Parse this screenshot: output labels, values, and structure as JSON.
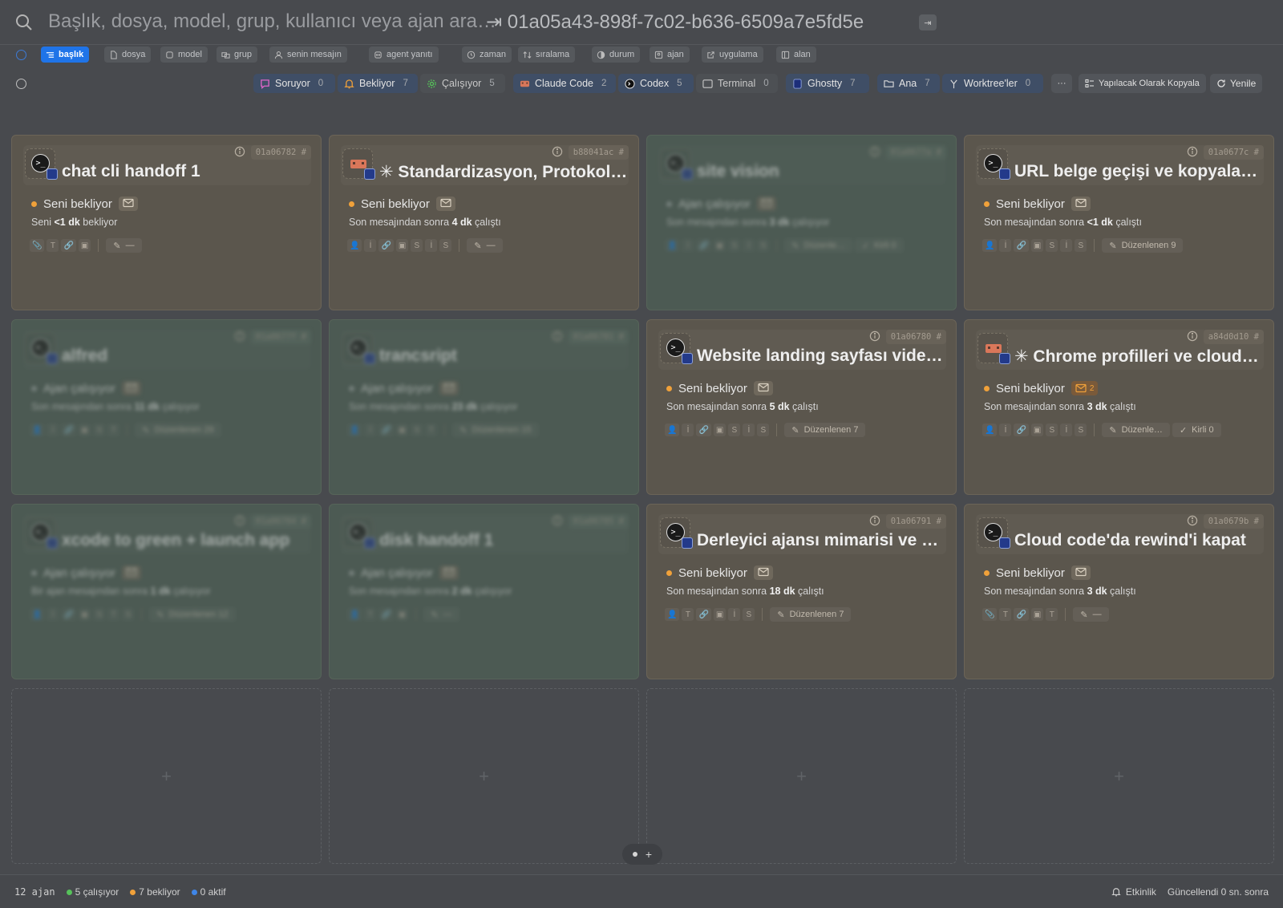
{
  "search": {
    "placeholder": "Başlık, dosya, model, grup, kullanıcı veya ajan ara…",
    "current_id": "01a05a43-898f-7c02-b636-6509a7e5fd5e",
    "arrow": "⇥",
    "tab_key": "⇥"
  },
  "filters": [
    {
      "label": "başlık",
      "icon": "list-icon",
      "active": true
    },
    {
      "label": "dosya",
      "icon": "file-icon"
    },
    {
      "label": "model",
      "icon": "cube-icon"
    },
    {
      "label": "grup",
      "icon": "group-icon"
    },
    {
      "label": "senin mesajın",
      "icon": "user-icon"
    },
    {
      "label": "agent yanıtı",
      "icon": "bot-icon"
    },
    {
      "label": "zaman",
      "icon": "clock-icon"
    },
    {
      "label": "sıralama",
      "icon": "sort-icon"
    },
    {
      "label": "durum",
      "icon": "half-circle-icon"
    },
    {
      "label": "ajan",
      "icon": "agent-icon"
    },
    {
      "label": "uygulama",
      "icon": "external-icon"
    },
    {
      "label": "alan",
      "icon": "panel-icon"
    }
  ],
  "status_bar": {
    "soruyor": {
      "label": "Soruyor",
      "count": "0"
    },
    "bekliyor": {
      "label": "Bekliyor",
      "count": "7"
    },
    "calisiyor": {
      "label": "Çalışıyor",
      "count": "5"
    },
    "claude": {
      "label": "Claude Code",
      "count": "2"
    },
    "codex": {
      "label": "Codex",
      "count": "5"
    },
    "terminal": {
      "label": "Terminal",
      "count": "0"
    },
    "ghostty": {
      "label": "Ghostty",
      "count": "7"
    },
    "ana": {
      "label": "Ana",
      "count": "7"
    },
    "worktree": {
      "label": "Worktree'ler",
      "count": "0"
    },
    "more": "···",
    "copy_todo": "Yapılacak Olarak Kopyala",
    "refresh": "Yenile"
  },
  "cards": [
    {
      "id": "01a06782 #",
      "title": "chat cli handoff 1",
      "status": "Seni bekliyor",
      "sub_pre": "Seni ",
      "sub_bold": "<1 dk",
      "sub_post": " bekliyor",
      "meta": [
        "T"
      ],
      "pill": "—"
    },
    {
      "id": "b88041ac #",
      "title": "✳ Standardizasyon, Protokol…",
      "status": "Seni bekliyor",
      "sub_pre": "Son mesajından sonra ",
      "sub_bold": "4 dk",
      "sub_post": " çalıştı",
      "meta": [
        "İ",
        "S",
        "İ",
        "S"
      ],
      "pill": "—"
    },
    {
      "id": "01a0677a #",
      "title": "site vision",
      "status": "Ajan çalışıyor",
      "sub_pre": "Son mesajından sonra ",
      "sub_bold": "3 dk",
      "sub_post": " çalışıyor",
      "meta": [
        "İ",
        "S",
        "İ",
        "S"
      ],
      "pill": "Düzenle…",
      "pill2": "Kirli 0"
    },
    {
      "id": "01a0677c #",
      "title": "URL belge geçişi ve kopyala…",
      "status": "Seni bekliyor",
      "sub_pre": "Son mesajından sonra ",
      "sub_bold": "<1 dk",
      "sub_post": " çalıştı",
      "meta": [
        "İ",
        "S",
        "İ",
        "S"
      ],
      "pill": "Düzenlenen 9"
    },
    {
      "id": "01a0677f #",
      "title": "alfred",
      "status": "Ajan çalışıyor",
      "sub_pre": "Son mesajından sonra ",
      "sub_bold": "11 dk",
      "sub_post": " çalışıyor",
      "meta": [
        "İ",
        "S",
        "T"
      ],
      "pill": "Düzenlenen 29"
    },
    {
      "id": "01a06781 #",
      "title": "trancsript",
      "status": "Ajan çalışıyor",
      "sub_pre": "Son mesajından sonra ",
      "sub_bold": "23 dk",
      "sub_post": " çalışıyor",
      "meta": [
        "İ",
        "S",
        "T"
      ],
      "pill": "Düzenlenen 15"
    },
    {
      "id": "01a06780 #",
      "title": "Website landing sayfası vide…",
      "status": "Seni bekliyor",
      "sub_pre": "Son mesajından sonra ",
      "sub_bold": "5 dk",
      "sub_post": " çalıştı",
      "meta": [
        "İ",
        "S",
        "İ",
        "S"
      ],
      "pill": "Düzenlenen 7"
    },
    {
      "id": "a84d0d10 #",
      "title": "✳ Chrome profilleri ve cloud…",
      "status": "Seni bekliyor",
      "mail_count": "2",
      "sub_pre": "Son mesajından sonra ",
      "sub_bold": "3 dk",
      "sub_post": " çalıştı",
      "meta": [
        "İ",
        "S",
        "İ",
        "S"
      ],
      "pill": "Düzenle…",
      "pill2": "Kirli 0"
    },
    {
      "id": "01a06784 #",
      "title": "xcode to green + launch app",
      "status": "Ajan çalışıyor",
      "sub_pre": "Bir ajan mesajından sonra ",
      "sub_bold": "1 dk",
      "sub_post": " çalışıyor",
      "meta": [
        "İ",
        "S",
        "T",
        "S"
      ],
      "pill": "Düzenlenen 12"
    },
    {
      "id": "01a06785 #",
      "title": "disk handoff 1",
      "status": "Ajan çalışıyor",
      "sub_pre": "Son mesajından sonra ",
      "sub_bold": "2 dk",
      "sub_post": " çalışıyor",
      "meta": [
        "T"
      ],
      "pill": "—"
    },
    {
      "id": "01a06791 #",
      "title": "Derleyici ajansı mimarisi ve s…",
      "status": "Seni bekliyor",
      "sub_pre": "Son mesajından sonra ",
      "sub_bold": "18 dk",
      "sub_post": " çalıştı",
      "meta": [
        "T",
        "İ",
        "S"
      ],
      "pill": "Düzenlenen 7"
    },
    {
      "id": "01a0679b #",
      "title": "Cloud code'da rewind'i kapat",
      "status": "Seni bekliyor",
      "sub_pre": "Son mesajından sonra ",
      "sub_bold": "3 dk",
      "sub_post": " çalıştı",
      "meta": [
        "T",
        "T"
      ],
      "pill": "—"
    }
  ],
  "pager_plus": "+",
  "slot_plus": "+",
  "footer": {
    "agents": "12 ajan",
    "working": "5 çalışıyor",
    "waiting": "7 bekliyor",
    "active": "0 aktif",
    "activity": "Etkinlik",
    "updated": "Güncellendi 0 sn. sonra"
  },
  "colors": {
    "accent": "#1f74e8",
    "waiting_dot": "#f0a13a",
    "working_dot": "#56c25a",
    "active_dot": "#3f86e8",
    "card_waiting_bg": "#5b564d",
    "card_working_bg": "#4c5a53"
  }
}
